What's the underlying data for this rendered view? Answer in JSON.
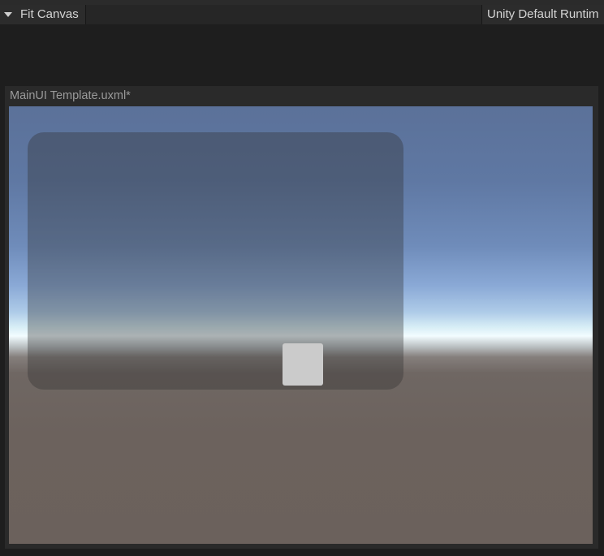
{
  "toolbar": {
    "dropdown_icon": "triangle-down-icon",
    "canvas_mode": "Fit Canvas",
    "theme": "Unity Default Runtim"
  },
  "document": {
    "title": "MainUI Template.uxml*"
  },
  "colors": {
    "editor_bg": "#1e1e1e",
    "panel_bg": "#2a2a2a",
    "button_fill": "#cbcbcb"
  }
}
